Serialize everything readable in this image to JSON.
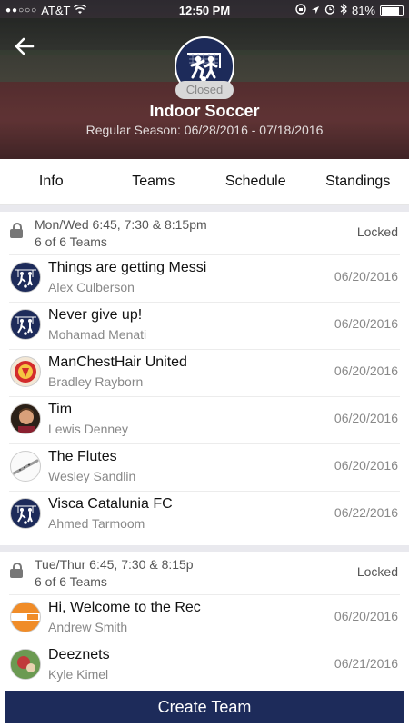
{
  "status_bar": {
    "carrier": "AT&T",
    "signal": "●●○○○",
    "time": "12:50 PM",
    "battery": "81%"
  },
  "header": {
    "title": "Indoor Soccer",
    "subtitle": "Regular Season: 06/28/2016 - 07/18/2016",
    "status_badge": "Closed"
  },
  "tabs": [
    "Info",
    "Teams",
    "Schedule",
    "Standings"
  ],
  "groups": [
    {
      "title": "Mon/Wed 6:45, 7:30 & 8:15pm",
      "count": "6 of 6 Teams",
      "status": "Locked",
      "teams": [
        {
          "name": "Things are getting Messi",
          "captain": "Alex Culberson",
          "date": "06/20/2016",
          "avatar": "soccer-logo"
        },
        {
          "name": "Never give up!",
          "captain": "Mohamad Menati",
          "date": "06/20/2016",
          "avatar": "soccer-logo"
        },
        {
          "name": "ManChestHair United",
          "captain": "Bradley Rayborn",
          "date": "06/20/2016",
          "avatar": "crest"
        },
        {
          "name": "Tim",
          "captain": "Lewis Denney",
          "date": "06/20/2016",
          "avatar": "photo"
        },
        {
          "name": "The Flutes",
          "captain": "Wesley Sandlin",
          "date": "06/20/2016",
          "avatar": "flute"
        },
        {
          "name": "Visca Catalunia FC",
          "captain": "Ahmed Tarmoom",
          "date": "06/22/2016",
          "avatar": "soccer-logo"
        }
      ]
    },
    {
      "title": "Tue/Thur 6:45, 7:30 & 8:15p",
      "count": "6 of 6 Teams",
      "status": "Locked",
      "teams": [
        {
          "name": "Hi, Welcome to the Rec",
          "captain": "Andrew Smith",
          "date": "06/20/2016",
          "avatar": "rec-logo"
        },
        {
          "name": "Deeznets",
          "captain": "Kyle Kimel",
          "date": "06/21/2016",
          "avatar": "photo"
        }
      ]
    }
  ],
  "create_button": "Create Team",
  "colors": {
    "brand_navy": "#1d2b5a",
    "divider": "#e9e9ee"
  }
}
